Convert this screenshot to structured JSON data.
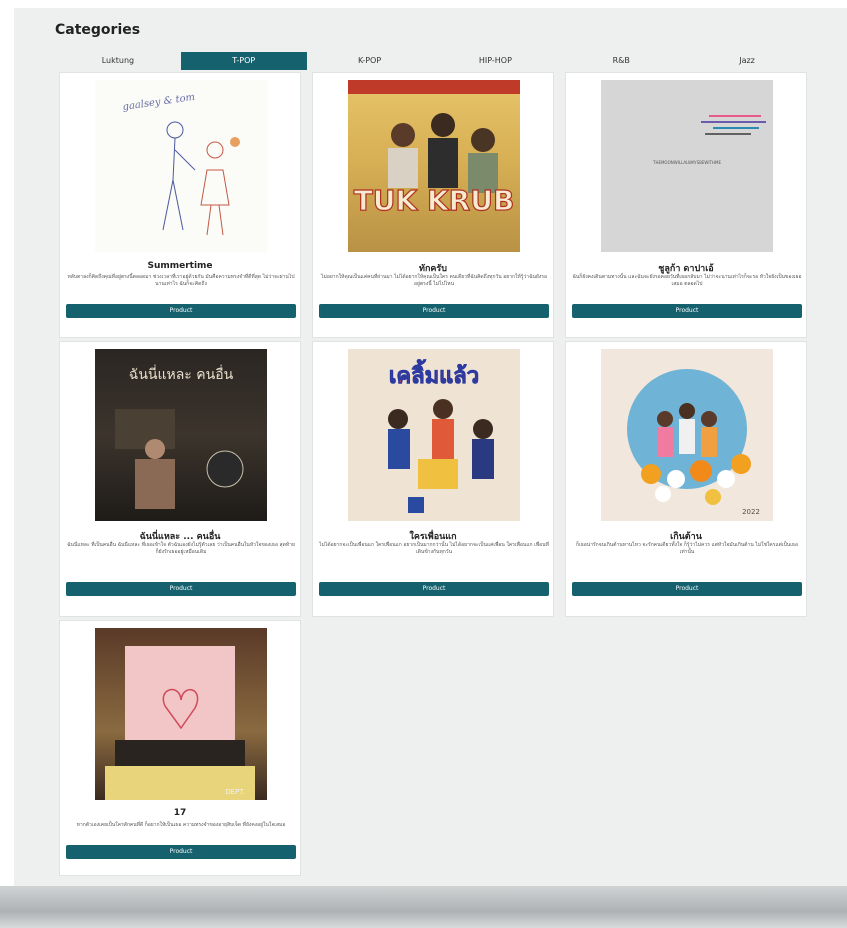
{
  "page": {
    "title": "Categories"
  },
  "tabs": [
    {
      "label": "Luktung"
    },
    {
      "label": "T-POP"
    },
    {
      "label": "K-POP"
    },
    {
      "label": "HIP-HOP"
    },
    {
      "label": "R&B"
    },
    {
      "label": "Jazz"
    }
  ],
  "cards": [
    {
      "title": "Summertime",
      "desc": "หลับตาลงก็คิดถึงคุณที่อยู่ตรงนี้ตลอดมา ช่วงเวลาที่เราอยู่ด้วยกัน มันคือความทรงจำที่ดีที่สุด ไม่ว่าจะผ่านไปนานเท่าไร ฉันก็จะคิดถึง",
      "button": "Product",
      "art_text": "gaalsey & tom"
    },
    {
      "title": "ทักครับ",
      "desc": "ไม่อยากให้คุณเป็นแค่คนที่ผ่านมา ไม่ได้อยากให้คุณเป็นใคร คนเดียวที่ฉันคิดถึงทุกวัน อยากให้รู้ว่าฉันยังรออยู่ตรงนี้ ไม่ไปไหน",
      "button": "Product",
      "art_text": "TUK KRUB"
    },
    {
      "title": "ชูลูก้า ดาปาเอ้",
      "desc": "ฉันก็ยังคงเดินตามทางนั้น และฉันจะยังรอคอยวันที่เธอกลับมา ไม่ว่าจะนานเท่าไรก็จะรอ หัวใจยังเป็นของเธอเสมอ ตลอดไป",
      "button": "Product",
      "art_text": "THEMOONWILLALWAYSBEWITHME"
    },
    {
      "title": "ฉันนี่แหละ ... คนอื่น",
      "desc": "ฉันนี่แหละ ที่เป็นคนอื่น ฉันนี่แหละ ที่เธอเข้าใจ ตัวฉันเองยังไม่รู้ตัวเลย ว่าเป็นคนอื่นในหัวใจของเธอ สุดท้ายก็ยังรักเธออยู่เหมือนเดิม",
      "button": "Product",
      "art_text": "ฉันนี่แหละ คนอื่น"
    },
    {
      "title": "ใครเพื่อนแก",
      "desc": "ไม่ได้อยากจะเป็นเพื่อนแก ใครเพื่อนแก อยากเป็นมากกว่านั้น ไม่ได้อยากจะเป็นแค่เพื่อน ใครเพื่อนแก เพื่อนที่เดินข้างกันทุกวัน",
      "button": "Product",
      "art_text": "เคลิ้มแล้ว"
    },
    {
      "title": "เกินต้าน",
      "desc": "ก็เธอน่ารักจนเกินต้านทานไหว จะรักคนเดียวทั้งใจ ก็รู้ว่าไม่ควร แต่หัวใจมันเกินต้าน ไม่ใช่ใครแต่เป็นเธอเท่านั้น",
      "button": "Product",
      "art_text": "2022"
    },
    {
      "title": "17",
      "desc": "หากตัวเองเคยเป็นใครสักคนที่ดี ก็อยากให้เป็นเธอ ความทรงจำของอายุสิบเจ็ด ที่ยังคงอยู่ในใจเสมอ",
      "button": "Product",
      "art_text": "DEPT."
    }
  ]
}
